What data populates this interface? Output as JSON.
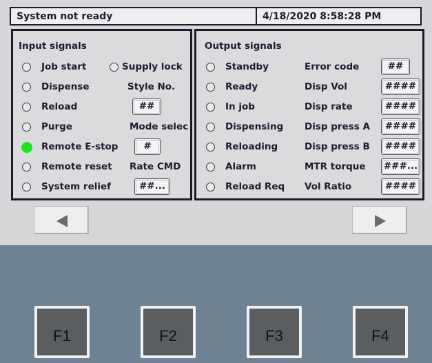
{
  "status_bar": {
    "message": "System not ready",
    "datetime": "4/18/2020 8:58:28 PM"
  },
  "input_signals": {
    "title": "Input signals",
    "supply_lock": "Supply lock",
    "rows": [
      {
        "label": "Job start",
        "state": "off"
      },
      {
        "label": "Dispense",
        "state": "off"
      },
      {
        "label": "Reload",
        "state": "off"
      },
      {
        "label": "Purge",
        "state": "off"
      },
      {
        "label": "Remote E-stop",
        "state": "on"
      },
      {
        "label": "Remote reset",
        "state": "off"
      },
      {
        "label": "System relief",
        "state": "off"
      }
    ],
    "style_no_label": "Style No.",
    "style_no_value": "##",
    "mode_select_label": "Mode selec",
    "mode_select_value": "#",
    "rate_cmd_label": "Rate CMD",
    "rate_cmd_value": "##..."
  },
  "output_signals": {
    "title": "Output signals",
    "rows": [
      {
        "label": "Standby",
        "state": "off"
      },
      {
        "label": "Ready",
        "state": "off"
      },
      {
        "label": "In job",
        "state": "off"
      },
      {
        "label": "Dispensing",
        "state": "off"
      },
      {
        "label": "Reloading",
        "state": "off"
      },
      {
        "label": "Alarm",
        "state": "off"
      },
      {
        "label": "Reload Req",
        "state": "off"
      }
    ],
    "values": [
      {
        "label": "Error code",
        "value": "##"
      },
      {
        "label": "Disp Vol",
        "value": "####"
      },
      {
        "label": "Disp rate",
        "value": "####"
      },
      {
        "label": "Disp press A",
        "value": "####"
      },
      {
        "label": "Disp press B",
        "value": "####"
      },
      {
        "label": "MTR torque",
        "value": "###..."
      },
      {
        "label": "Vol Ratio",
        "value": "####"
      }
    ]
  },
  "navigation": {
    "prev_icon": "triangle-left-icon",
    "next_icon": "triangle-right-icon"
  },
  "function_keys": [
    "F1",
    "F2",
    "F3",
    "F4"
  ],
  "colors": {
    "indicator_on": "#19e619",
    "hmi_background": "#6d8394",
    "screen_background": "#d6d7d8"
  }
}
